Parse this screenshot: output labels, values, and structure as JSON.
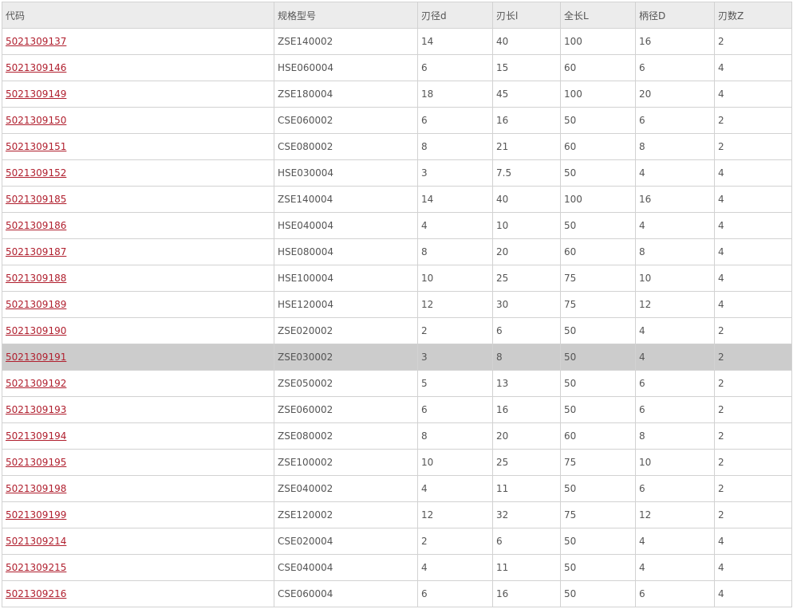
{
  "table": {
    "headers": [
      "代码",
      "规格型号",
      "刃径d",
      "刃长l",
      "全长L",
      "柄径D",
      "刃数Z"
    ],
    "rows": [
      [
        "5021309137",
        "ZSE140002",
        "14",
        "40",
        "100",
        "16",
        "2"
      ],
      [
        "5021309146",
        "HSE060004",
        "6",
        "15",
        "60",
        "6",
        "4"
      ],
      [
        "5021309149",
        "ZSE180004",
        "18",
        "45",
        "100",
        "20",
        "4"
      ],
      [
        "5021309150",
        "CSE060002",
        "6",
        "16",
        "50",
        "6",
        "2"
      ],
      [
        "5021309151",
        "CSE080002",
        "8",
        "21",
        "60",
        "8",
        "2"
      ],
      [
        "5021309152",
        "HSE030004",
        "3",
        "7.5",
        "50",
        "4",
        "4"
      ],
      [
        "5021309185",
        "ZSE140004",
        "14",
        "40",
        "100",
        "16",
        "4"
      ],
      [
        "5021309186",
        "HSE040004",
        "4",
        "10",
        "50",
        "4",
        "4"
      ],
      [
        "5021309187",
        "HSE080004",
        "8",
        "20",
        "60",
        "8",
        "4"
      ],
      [
        "5021309188",
        "HSE100004",
        "10",
        "25",
        "75",
        "10",
        "4"
      ],
      [
        "5021309189",
        "HSE120004",
        "12",
        "30",
        "75",
        "12",
        "4"
      ],
      [
        "5021309190",
        "ZSE020002",
        "2",
        "6",
        "50",
        "4",
        "2"
      ],
      [
        "5021309191",
        "ZSE030002",
        "3",
        "8",
        "50",
        "4",
        "2"
      ],
      [
        "5021309192",
        "ZSE050002",
        "5",
        "13",
        "50",
        "6",
        "2"
      ],
      [
        "5021309193",
        "ZSE060002",
        "6",
        "16",
        "50",
        "6",
        "2"
      ],
      [
        "5021309194",
        "ZSE080002",
        "8",
        "20",
        "60",
        "8",
        "2"
      ],
      [
        "5021309195",
        "ZSE100002",
        "10",
        "25",
        "75",
        "10",
        "2"
      ],
      [
        "5021309198",
        "ZSE040002",
        "4",
        "11",
        "50",
        "6",
        "2"
      ],
      [
        "5021309199",
        "ZSE120002",
        "12",
        "32",
        "75",
        "12",
        "2"
      ],
      [
        "5021309214",
        "CSE020004",
        "2",
        "6",
        "50",
        "4",
        "4"
      ],
      [
        "5021309215",
        "CSE040004",
        "4",
        "11",
        "50",
        "4",
        "4"
      ],
      [
        "5021309216",
        "CSE060004",
        "6",
        "16",
        "50",
        "6",
        "4"
      ]
    ],
    "selected_row_index": 12
  },
  "colors": {
    "link": "#b01f2e",
    "header_bg": "#ececec",
    "selected_bg": "#cccccc",
    "border": "#d2d2d2"
  }
}
